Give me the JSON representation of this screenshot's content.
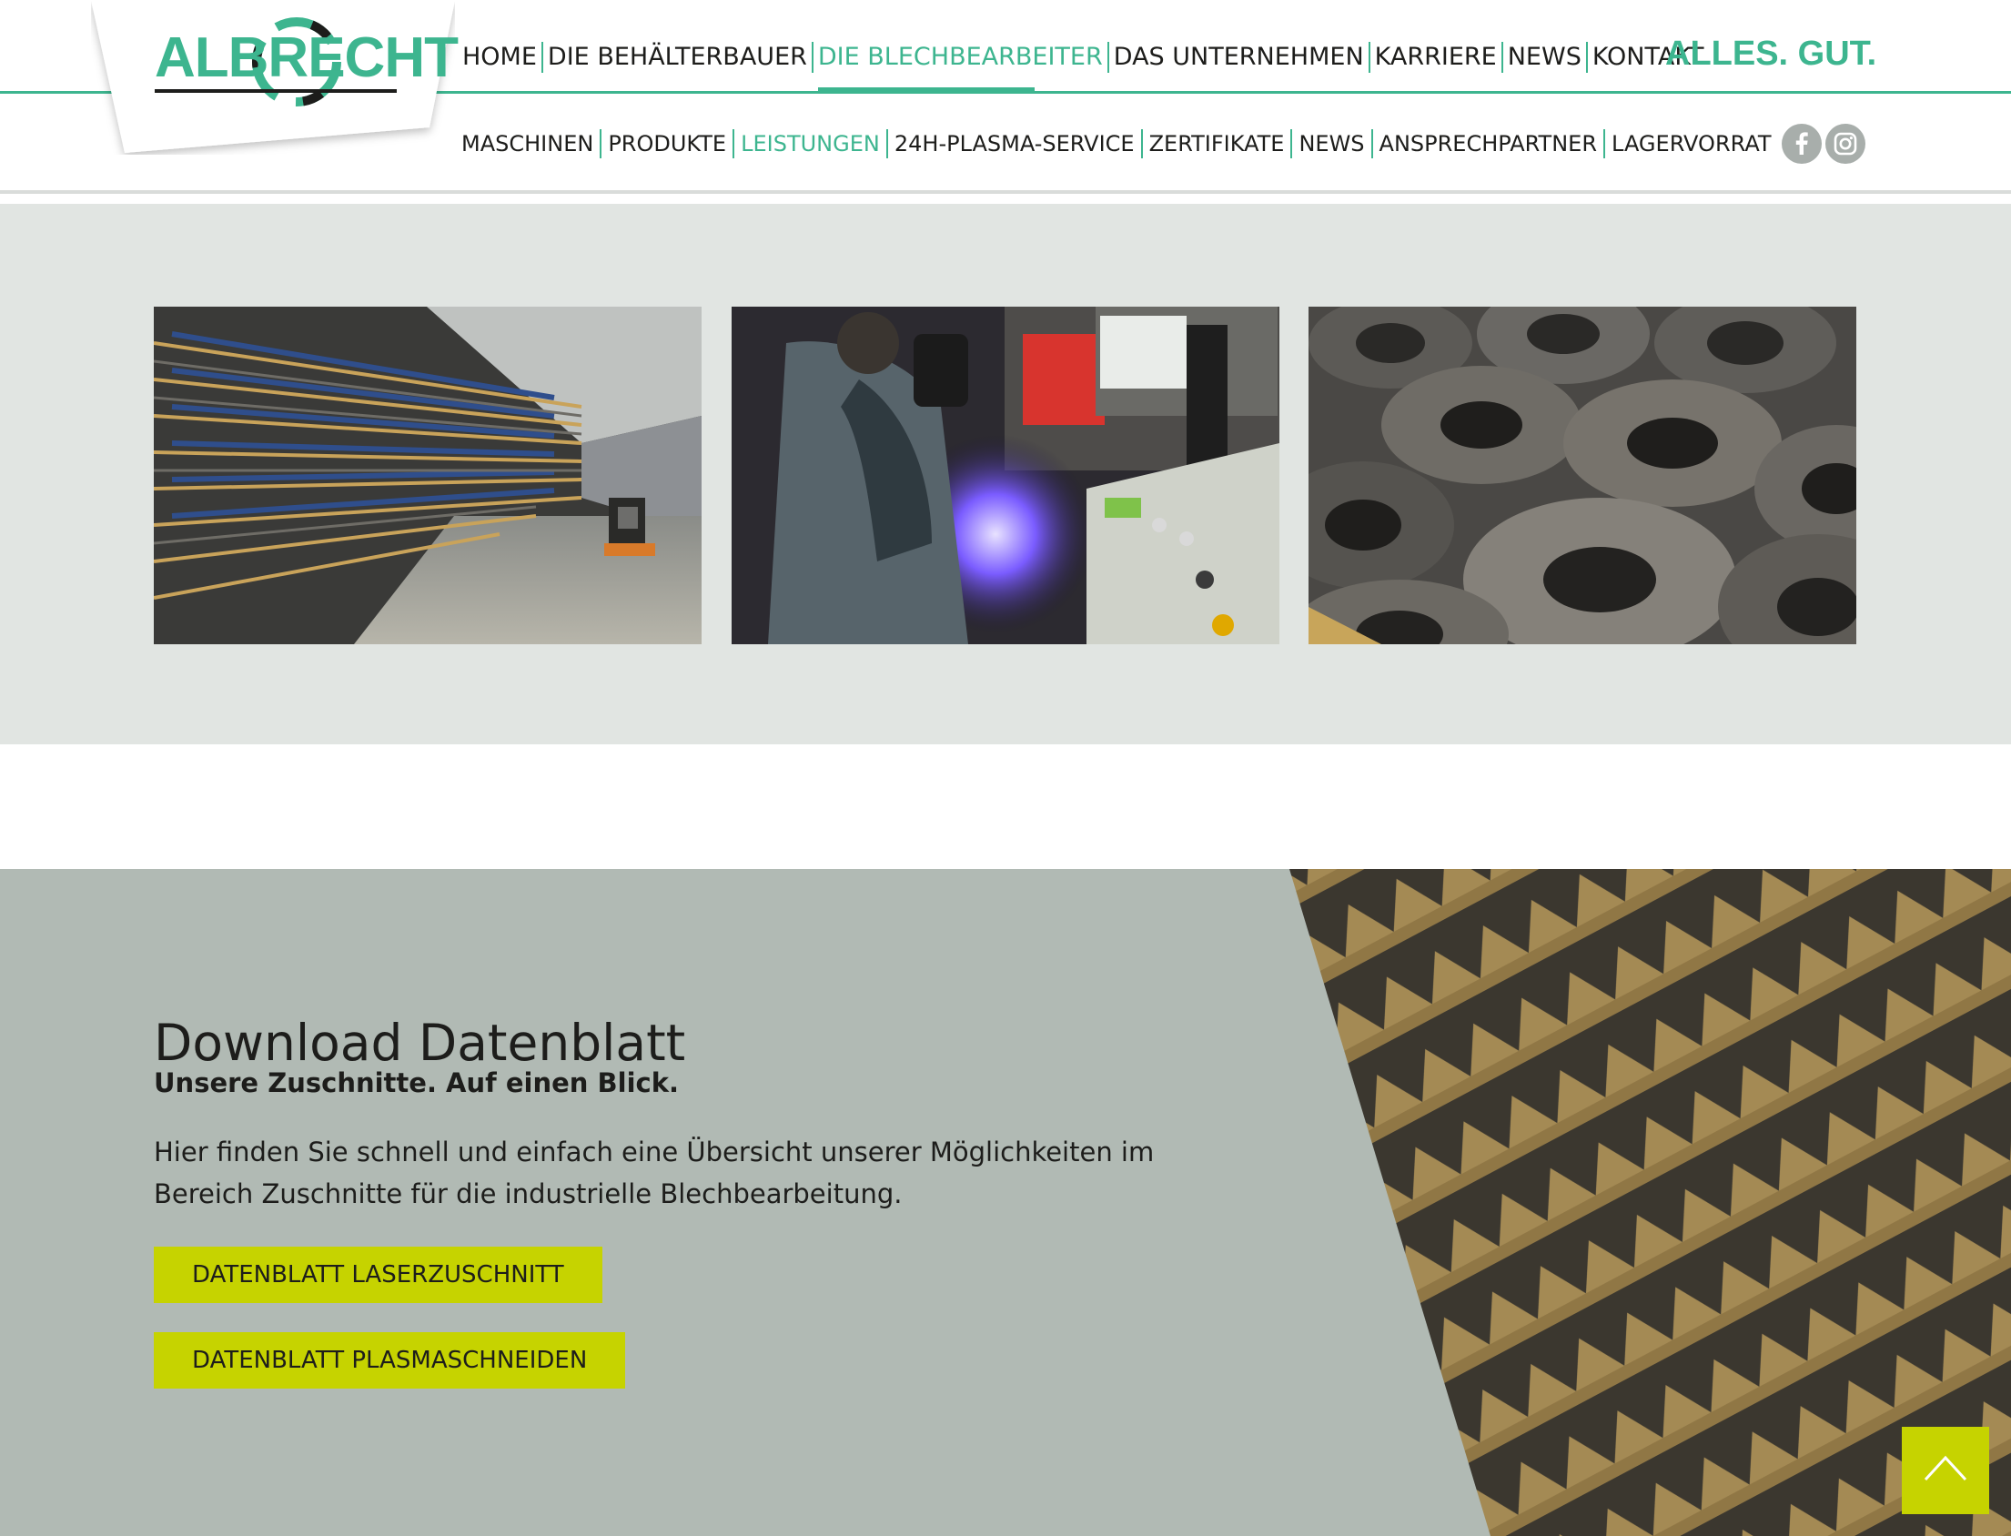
{
  "brand": {
    "logo_text": "ALBRECHT",
    "slogan": "ALLES. GUT.",
    "accent_color": "#3db58f",
    "button_color": "#c6d300"
  },
  "main_nav": {
    "items": [
      {
        "label": "HOME"
      },
      {
        "label": "DIE BEHÄLTERBAUER"
      },
      {
        "label": "DIE BLECHBEARBEITER",
        "active": true
      },
      {
        "label": "DAS UNTERNEHMEN"
      },
      {
        "label": "KARRIERE"
      },
      {
        "label": "NEWS"
      },
      {
        "label": "KONTAKT"
      }
    ]
  },
  "sub_nav": {
    "items": [
      {
        "label": "MASCHINEN"
      },
      {
        "label": "PRODUKTE"
      },
      {
        "label": "LEISTUNGEN",
        "active": true
      },
      {
        "label": "24H-PLASMA-SERVICE"
      },
      {
        "label": "ZERTIFIKATE"
      },
      {
        "label": "NEWS"
      },
      {
        "label": "ANSPRECHPARTNER"
      },
      {
        "label": "LAGERVORRAT"
      }
    ]
  },
  "social": {
    "icons": [
      "facebook-icon",
      "instagram-icon"
    ]
  },
  "gallery": {
    "images": [
      "sheet-metal-warehouse-photo",
      "plasma-cutting-operator-photo",
      "cut-steel-rings-photo"
    ]
  },
  "download": {
    "title": "Download Datenblatt",
    "subtitle": "Unsere Zuschnitte. Auf einen Blick.",
    "body": "Hier finden Sie schnell und einfach eine Übersicht unserer Möglichkeiten im Bereich Zuschnitte für die industrielle Blechbearbeitung.",
    "buttons": [
      {
        "label": "DATENBLATT LASERZUSCHNITT"
      },
      {
        "label": "DATENBLATT PLASMASCHNEIDEN"
      }
    ]
  },
  "scroll_top": {
    "icon": "chevron-up-icon"
  }
}
